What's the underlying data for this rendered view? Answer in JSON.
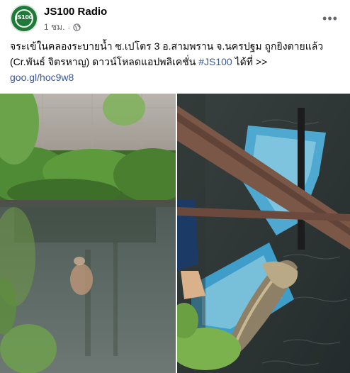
{
  "page": {
    "name": "JS100 Radio",
    "logo_text": "JS100",
    "time": "1 ชม.",
    "separator": "·",
    "privacy_icon": "globe-icon",
    "more_icon": "ellipsis-icon",
    "more_label": "•••"
  },
  "post": {
    "line1": "จระเข้ในคลองระบายน้ำ ซ.เปโตร 3 อ.สามพราน จ.นครปฐม ถูกยิงตายแล้ว",
    "line2_prefix": "(Cr.พันธ์ จิตรหาญ) ดาวน์โหลดแอปพลิเคชั่น ",
    "hashtag": "#JS100",
    "line2_suffix": " ได้ที่ >>",
    "url": "goo.gl/hoc9w8"
  },
  "colors": {
    "link": "#385898",
    "meta": "#65676b",
    "brand": "#1f7a3a"
  }
}
